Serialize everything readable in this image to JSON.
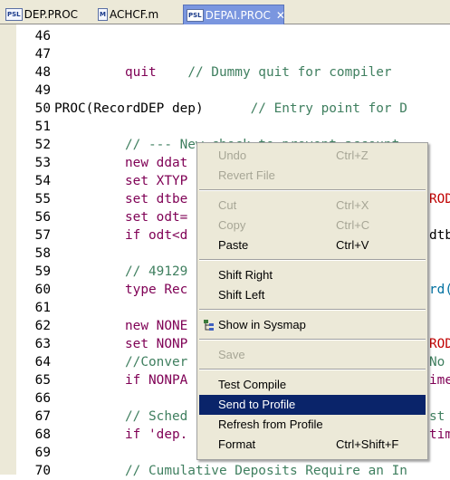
{
  "tabs": [
    {
      "icon": "PSL",
      "label": "DEP.PROC"
    },
    {
      "icon": "M",
      "label": "ACHCF.m"
    },
    {
      "icon": "PSL",
      "label": "DEPAI.PROC"
    }
  ],
  "editor": {
    "line_numbers": [
      "46",
      "47",
      "48",
      "49",
      "50",
      "51",
      "52",
      "53",
      "54",
      "55",
      "56",
      "57",
      "58",
      "59",
      "60",
      "61",
      "62",
      "63",
      "64",
      "65",
      "66",
      "67",
      "68",
      "69",
      "70"
    ],
    "code": {
      "l48_kw": "quit",
      "l48_cm": "// Dummy quit for compiler",
      "l50_a": "PROC(RecordDEP dep)",
      "l50_cm": "// Entry point for D",
      "l52_cm": "// --- New check to prevent account",
      "l53": "new ddat",
      "l54": "set XTYP",
      "l55": "set dtbe",
      "l55_r": "ROD",
      "l56": "set odt=",
      "l57": "if odt<d",
      "l57_r": "dtb",
      "l59_cm": "// 49129",
      "l60": "type Rec",
      "l60_r": "rd(",
      "l62": "new NONE",
      "l63": "set NONP",
      "l63_r": "ROD",
      "l64_cm": "//Conver",
      "l64_r": "No",
      "l65": "if NONPA",
      "l65_r": "ime",
      "l67_cm": "// Sched",
      "l67_r": "st",
      "l68": "if 'dep.",
      "l68_r": "tim",
      "l70_cm": "// Cumulative Deposits Require an In"
    }
  },
  "context_menu": {
    "items": [
      {
        "label": "Undo",
        "accel": "Ctrl+Z"
      },
      {
        "label": "Revert File",
        "accel": ""
      },
      {
        "label": "Cut",
        "accel": "Ctrl+X"
      },
      {
        "label": "Copy",
        "accel": "Ctrl+C"
      },
      {
        "label": "Paste",
        "accel": "Ctrl+V"
      },
      {
        "label": "Shift Right",
        "accel": ""
      },
      {
        "label": "Shift Left",
        "accel": ""
      },
      {
        "label": "Show in Sysmap",
        "accel": ""
      },
      {
        "label": "Save",
        "accel": ""
      },
      {
        "label": "Test Compile",
        "accel": ""
      },
      {
        "label": "Send to Profile",
        "accel": ""
      },
      {
        "label": "Refresh from Profile",
        "accel": ""
      },
      {
        "label": "Format",
        "accel": "Ctrl+Shift+F"
      }
    ],
    "highlighted": "Send to Profile",
    "highlight_color": "#0a246a"
  }
}
